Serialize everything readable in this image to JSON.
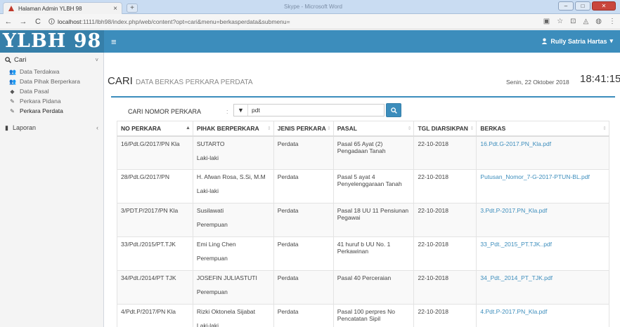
{
  "browser": {
    "tab_title": "Halaman Admin YLBH 98",
    "tab_close": "×",
    "new_tab": "+",
    "window_title": "Skype - Microsoft Word",
    "url_host": "localhost",
    "url_rest": ":1111/lbh98/index.php/web/content?opt=cari&menu=berkasperdata&submenu="
  },
  "header": {
    "logo": "YLBH 98",
    "user_name": "Rully Satria Hartas"
  },
  "sidebar": {
    "cari_label": "Cari",
    "items": [
      {
        "label": "Data Terdakwa",
        "icon": "users-icon"
      },
      {
        "label": "Data Pihak Berperkara",
        "icon": "users-icon"
      },
      {
        "label": "Data Pasal",
        "icon": "tag-icon"
      },
      {
        "label": "Perkara Pidana",
        "icon": "edit-icon"
      },
      {
        "label": "Perkara Perdata",
        "icon": "edit-icon"
      }
    ],
    "laporan_label": "Laporan"
  },
  "page": {
    "title": "CARI",
    "subtitle": "DATA BERKAS PERKARA PERDATA",
    "date": "Senin, 22 Oktober 2018",
    "time": "18:41:15"
  },
  "search": {
    "label": "CARI NOMOR PERKARA",
    "colon": ":",
    "value": "pdt"
  },
  "table": {
    "headers": [
      "NO PERKARA",
      "PIHAK BERPERKARA",
      "JENIS PERKARA",
      "PASAL",
      "TGL DIARSIKPAN",
      "BERKAS"
    ],
    "rows": [
      {
        "no": "16/Pdt.G/2017/PN Kla",
        "pihak": "SUTARTO",
        "sex": "Laki-laki",
        "jenis": "Perdata",
        "pasal": "Pasal 65 Ayat (2) Pengadaan Tanah",
        "tgl": "22-10-2018",
        "berkas": "16.Pdt.G-2017.PN_Kla.pdf"
      },
      {
        "no": "28/Pdt.G/2017/PN",
        "pihak": "H. Afwan Rosa, S.Si, M.M",
        "sex": "Laki-laki",
        "jenis": "Perdata",
        "pasal": "Pasal 5 ayat 4 Penyelenggaraan Tanah",
        "tgl": "22-10-2018",
        "berkas": "Putusan_Nomor_7-G-2017-PTUN-BL.pdf"
      },
      {
        "no": "3/PDT.P/2017/PN Kla",
        "pihak": "Susilawati",
        "sex": "Perempuan",
        "jenis": "Perdata",
        "pasal": "Pasal 18 UU 11 Pensiunan Pegawai",
        "tgl": "22-10-2018",
        "berkas": "3.Pdt.P-2017.PN_Kla.pdf"
      },
      {
        "no": "33/Pdt./2015/PT.TJK",
        "pihak": "Emi Ling Chen",
        "sex": "Perempuan",
        "jenis": "Perdata",
        "pasal": "41 huruf b UU No. 1 Perkawinan",
        "tgl": "22-10-2018",
        "berkas": "33_Pdt._2015_PT.TJK..pdf"
      },
      {
        "no": "34/Pdt./2014/PT TJK",
        "pihak": "JOSEFIN JULIASTUTI",
        "sex": "Perempuan",
        "jenis": "Perdata",
        "pasal": "Pasal 40 Perceraian",
        "tgl": "22-10-2018",
        "berkas": "34_Pdt._2014_PT_TJK.pdf"
      },
      {
        "no": "4/Pdt.P/2017/PN Kla",
        "pihak": "Rizki Oktonela Sijabat",
        "sex": "Laki-laki",
        "jenis": "Perdata",
        "pasal": "Pasal 100 perpres No Pencatatan Sipil",
        "tgl": "22-10-2018",
        "berkas": "4.Pdt.P-2017.PN_Kla.pdf"
      }
    ]
  },
  "colors": {
    "brand": "#3c8dbc",
    "logo_bg": "#367fa9",
    "link": "#3c8dbc"
  }
}
